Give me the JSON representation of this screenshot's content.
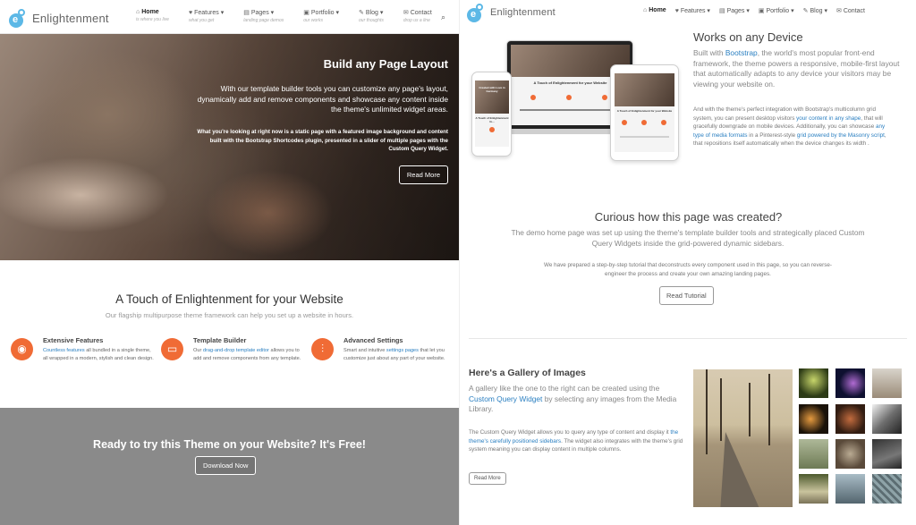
{
  "brand": {
    "name": "Enlightenment",
    "accent": "#f06b35",
    "link": "#2a7fc1"
  },
  "left_nav": [
    {
      "icon": "home-icon",
      "glyph": "⌂",
      "label": "Home",
      "sub": "is where you live",
      "active": true
    },
    {
      "icon": "heart-icon",
      "glyph": "♥",
      "label": "Features ▾",
      "sub": "what you get"
    },
    {
      "icon": "document-icon",
      "glyph": "▤",
      "label": "Pages ▾",
      "sub": "landing page demos"
    },
    {
      "icon": "briefcase-icon",
      "glyph": "▣",
      "label": "Portfolio ▾",
      "sub": "our works"
    },
    {
      "icon": "chat-icon",
      "glyph": "✎",
      "label": "Blog ▾",
      "sub": "our thoughts"
    },
    {
      "icon": "mail-icon",
      "glyph": "✉",
      "label": "Contact",
      "sub": "drop us a line"
    }
  ],
  "right_nav": [
    {
      "icon": "home-icon",
      "glyph": "⌂",
      "label": "Home",
      "active": true
    },
    {
      "icon": "heart-icon",
      "glyph": "♥",
      "label": "Features ▾"
    },
    {
      "icon": "document-icon",
      "glyph": "▤",
      "label": "Pages ▾"
    },
    {
      "icon": "briefcase-icon",
      "glyph": "▣",
      "label": "Portfolio ▾"
    },
    {
      "icon": "chat-icon",
      "glyph": "✎",
      "label": "Blog ▾"
    },
    {
      "icon": "mail-icon",
      "glyph": "✉",
      "label": "Contact"
    }
  ],
  "hero": {
    "title": "Build any Page Layout",
    "p1": "With our template builder tools you can customize any page's layout, dynamically add and remove components and showcase any content inside the theme's unlimited widget areas.",
    "p2": "What you're looking at right now is a static page with a featured image background and content built with the Bootstrap Shortcodes plugin, presented in a slider of multiple pages with the Custom Query Widget.",
    "button": "Read More"
  },
  "intro": {
    "title": "A Touch of Enlightenment for your Website",
    "subtitle": "Our flagship multipurpose theme framework can help you set up a website in hours."
  },
  "features": [
    {
      "icon": "bulb-icon",
      "glyph": "◉",
      "title": "Extensive Features",
      "link": "Countless features",
      "rest": " all bundled in a single theme, all wrapped in a modern, stylish and clean design."
    },
    {
      "icon": "monitor-icon",
      "glyph": "▭",
      "title": "Template Builder",
      "pre": "Our ",
      "link": "drag-and-drop template editor",
      "rest": " allows you to add and remove components from any template."
    },
    {
      "icon": "sliders-icon",
      "glyph": "⫶",
      "title": "Advanced Settings",
      "pre": "Smart and intuitive ",
      "link": "settings pages",
      "rest": " that let you customize just about any part of your website."
    }
  ],
  "cta": {
    "title": "Ready to try this Theme on your Website? It's Free!",
    "button": "Download Now"
  },
  "device": {
    "title": "Works on any Device",
    "p1_pre": "Built with ",
    "p1_link": "Bootstrap",
    "p1_post": ", the world's most popular front-end framework, the theme powers a responsive, mobile-first layout that automatically adapts to any device your visitors may be viewing your website on.",
    "p2_pre": "And with the theme's perfect integration with Bootstrap's multicolumn grid system, you can present desktop visitors ",
    "p2_link1": "your content in any shape",
    "p2_mid": ", that will gracefully downgrade on mobile devices. Additionally, you can showcase ",
    "p2_link2": "any type of media formats",
    "p2_mid2": " in a Pinterest-style ",
    "p2_link3": "grid powered by the Masonry script",
    "p2_post": ", that repositions itself automatically when the device changes its width .",
    "mock_title": "A Touch of Enlightenment for your Website",
    "mock_phone_title": "Created with Love in Germany",
    "mock_phone_title2": "A Touch of Enlightenment fo..."
  },
  "curious": {
    "title": "Curious how this page was created?",
    "p1": "The demo home page was set up using the theme's template builder tools and strategically placed Custom Query Widgets inside the grid-powered dynamic sidebars.",
    "p2": "We have prepared a step-by-step tutorial that deconstructs every component used in this page, so you can reverse-engineer the process and create your own amazing landing pages.",
    "button": "Read Tutorial"
  },
  "gallery": {
    "title": "Here's a Gallery of Images",
    "p1_pre": "A gallery like the one to the right can be created using the ",
    "p1_link": "Custom Query Widget",
    "p1_post": " by selecting any images from the Media Library.",
    "p2_pre": "The Custom Query Widget allows you to query any type of content and display it ",
    "p2_link": "the theme's carefully positioned sidebars",
    "p2_post": ". The widget also integrates with the theme's grid system meaning you can display content in multiple columns.",
    "button": "Read More"
  }
}
